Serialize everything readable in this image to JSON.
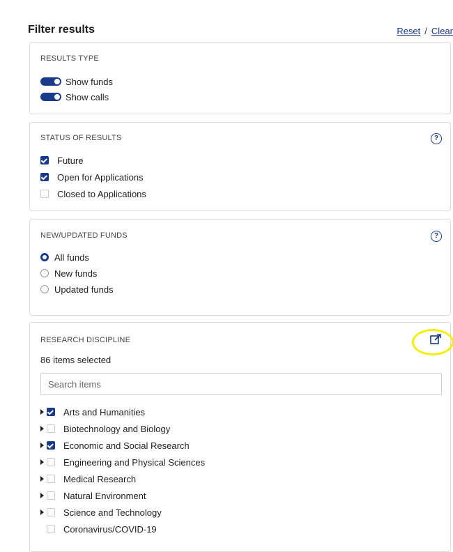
{
  "header": {
    "title": "Filter results",
    "reset_label": "Reset",
    "separator": "/",
    "clear_label": "Clear"
  },
  "results_type": {
    "heading": "RESULTS TYPE",
    "toggles": [
      {
        "label": "Show funds",
        "on": true
      },
      {
        "label": "Show calls",
        "on": true
      }
    ]
  },
  "status": {
    "heading": "STATUS OF RESULTS",
    "help_icon": "question-circle-icon",
    "options": [
      {
        "label": "Future",
        "checked": true
      },
      {
        "label": "Open for Applications",
        "checked": true
      },
      {
        "label": "Closed to Applications",
        "checked": false
      }
    ]
  },
  "new_updated": {
    "heading": "NEW/UPDATED FUNDS",
    "help_icon": "question-circle-icon",
    "options": [
      {
        "label": "All funds",
        "selected": true
      },
      {
        "label": "New funds",
        "selected": false
      },
      {
        "label": "Updated funds",
        "selected": false
      }
    ]
  },
  "research": {
    "heading": "RESEARCH DISCIPLINE",
    "external_icon": "external-link-icon",
    "count_text": "86 items selected",
    "search_placeholder": "Search items",
    "items": [
      {
        "label": "Arts and Humanities",
        "checked": true,
        "expandable": true
      },
      {
        "label": "Biotechnology and Biology",
        "checked": false,
        "expandable": true
      },
      {
        "label": "Economic and Social Research",
        "checked": true,
        "expandable": true
      },
      {
        "label": "Engineering and Physical Sciences",
        "checked": false,
        "expandable": true
      },
      {
        "label": "Medical Research",
        "checked": false,
        "expandable": true
      },
      {
        "label": "Natural Environment",
        "checked": false,
        "expandable": true
      },
      {
        "label": "Science and Technology",
        "checked": false,
        "expandable": true
      },
      {
        "label": "Coronavirus/COVID-19",
        "checked": false,
        "expandable": false
      }
    ]
  },
  "colors": {
    "accent": "#1b3a8c",
    "highlight": "#f3ef06",
    "border": "#dcdcdc"
  }
}
